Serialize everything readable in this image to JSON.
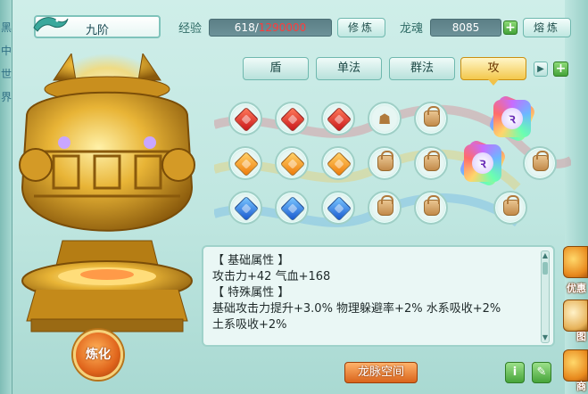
{
  "left_edge_glyphs": [
    "黑",
    "中",
    "世",
    "界"
  ],
  "header": {
    "name": "九阶",
    "exp_label": "经验",
    "exp_current": "618",
    "exp_separator": "/",
    "exp_max": "1290000",
    "cultivate_button": "修炼",
    "soul_label": "龙魂",
    "soul_value": "8085",
    "smelt_button": "熔炼"
  },
  "tabs": [
    {
      "label": "盾",
      "active": false
    },
    {
      "label": "单法",
      "active": false
    },
    {
      "label": "群法",
      "active": false
    },
    {
      "label": "攻",
      "active": true
    }
  ],
  "gem_grid": {
    "row1": [
      "red",
      "red",
      "red",
      "lock-figure",
      "lock"
    ],
    "row2": [
      "orange",
      "orange",
      "orange",
      "lock",
      "lock"
    ],
    "row3": [
      "blue",
      "blue",
      "blue",
      "lock",
      "lock"
    ],
    "special": [
      "star",
      "star",
      "lock",
      "lock"
    ]
  },
  "info": {
    "basic_header": "【 基础属性 】",
    "basic_values": "攻击力+42 气血+168",
    "special_header": "【 特殊属性 】",
    "special_line1": "基础攻击力提升+3.0% 物理躲避率+2% 水系吸收+2%",
    "special_line2": "土系吸收+2%"
  },
  "refine_button": "炼化",
  "dragon_space_button": "龙脉空间",
  "info_button": "i",
  "side_icons": [
    "优惠",
    "图",
    "商"
  ],
  "colors": {
    "exp_max": "#ff3b3b",
    "active_tab": "#f3c84c"
  }
}
